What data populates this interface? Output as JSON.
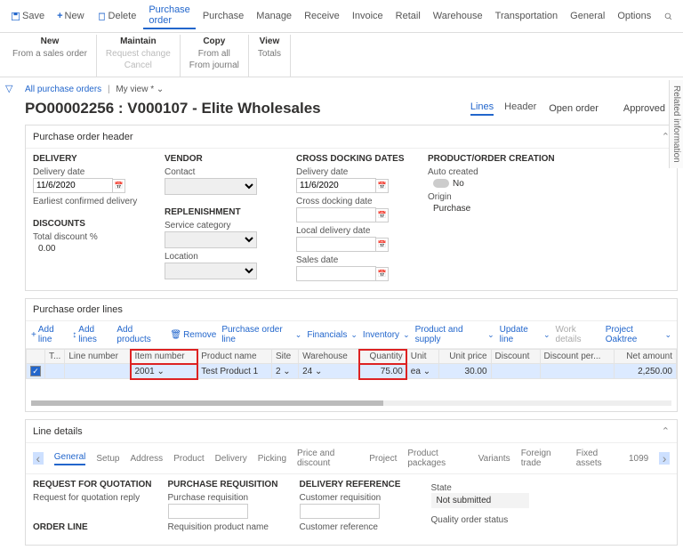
{
  "topbar": {
    "save": "Save",
    "new": "New",
    "delete": "Delete",
    "po": "Purchase order",
    "purchase": "Purchase",
    "manage": "Manage",
    "receive": "Receive",
    "invoice": "Invoice",
    "retail": "Retail",
    "warehouse": "Warehouse",
    "transportation": "Transportation",
    "general": "General",
    "options": "Options"
  },
  "ribbon": {
    "g1": {
      "hdr": "New",
      "r1": "From a sales order"
    },
    "g2": {
      "hdr": "Maintain",
      "r1": "Request change",
      "r2": "Cancel"
    },
    "g3": {
      "hdr": "Copy",
      "r1": "From all",
      "r2": "From journal"
    },
    "g4": {
      "hdr": "View",
      "r1": "Totals"
    }
  },
  "breadcrumb": {
    "all": "All purchase orders",
    "my": "My view *"
  },
  "title": "PO00002256 : V000107 - Elite Wholesales",
  "tabs": {
    "lines": "Lines",
    "header": "Header"
  },
  "status": {
    "open": "Open order",
    "approved": "Approved"
  },
  "hdrPanel": {
    "title": "Purchase order header",
    "delivery": {
      "h": "DELIVERY",
      "dateLbl": "Delivery date",
      "dateVal": "11/6/2020",
      "earliest": "Earliest confirmed delivery"
    },
    "discounts": {
      "h": "DISCOUNTS",
      "lbl": "Total discount %",
      "val": "0.00"
    },
    "vendor": {
      "h": "VENDOR",
      "contact": "Contact"
    },
    "replen": {
      "h": "REPLENISHMENT",
      "svc": "Service category",
      "loc": "Location"
    },
    "cross": {
      "h": "CROSS DOCKING DATES",
      "del": "Delivery date",
      "delVal": "11/6/2020",
      "cd": "Cross docking date",
      "ld": "Local delivery date",
      "sd": "Sales date"
    },
    "product": {
      "h": "PRODUCT/ORDER CREATION",
      "auto": "Auto created",
      "autoVal": "No",
      "origin": "Origin",
      "originVal": "Purchase"
    }
  },
  "linesPanel": {
    "title": "Purchase order lines",
    "toolbar": {
      "addLine": "Add line",
      "addLines": "Add lines",
      "addProducts": "Add products",
      "remove": "Remove",
      "pol": "Purchase order line",
      "fin": "Financials",
      "inv": "Inventory",
      "ps": "Product and supply",
      "upd": "Update line",
      "wd": "Work details",
      "proj": "Project Oaktree"
    },
    "cols": {
      "t": "T...",
      "lineNum": "Line number",
      "item": "Item number",
      "prod": "Product name",
      "site": "Site",
      "wh": "Warehouse",
      "qty": "Quantity",
      "unit": "Unit",
      "price": "Unit price",
      "disc": "Discount",
      "discPct": "Discount per...",
      "net": "Net amount"
    },
    "row": {
      "item": "2001",
      "prod": "Test Product 1",
      "site": "2",
      "wh": "24",
      "qty": "75.00",
      "unit": "ea",
      "price": "30.00",
      "net": "2,250.00"
    }
  },
  "detail": {
    "title": "Line details",
    "tabs": {
      "general": "General",
      "setup": "Setup",
      "address": "Address",
      "product": "Product",
      "delivery": "Delivery",
      "picking": "Picking",
      "pad": "Price and discount",
      "project": "Project",
      "pp": "Product packages",
      "variants": "Variants",
      "ft": "Foreign trade",
      "fa": "Fixed assets",
      "t1099": "1099"
    },
    "rfq": {
      "h": "REQUEST FOR QUOTATION",
      "l1": "Request for quotation reply"
    },
    "pr": {
      "h": "PURCHASE REQUISITION",
      "l1": "Purchase requisition",
      "l2": "Requisition product name"
    },
    "dr": {
      "h": "DELIVERY REFERENCE",
      "l1": "Customer requisition",
      "l2": "Customer reference"
    },
    "state": {
      "lbl": "State",
      "val": "Not submitted",
      "qos": "Quality order status"
    },
    "ol": "ORDER LINE"
  },
  "side": "Related information"
}
